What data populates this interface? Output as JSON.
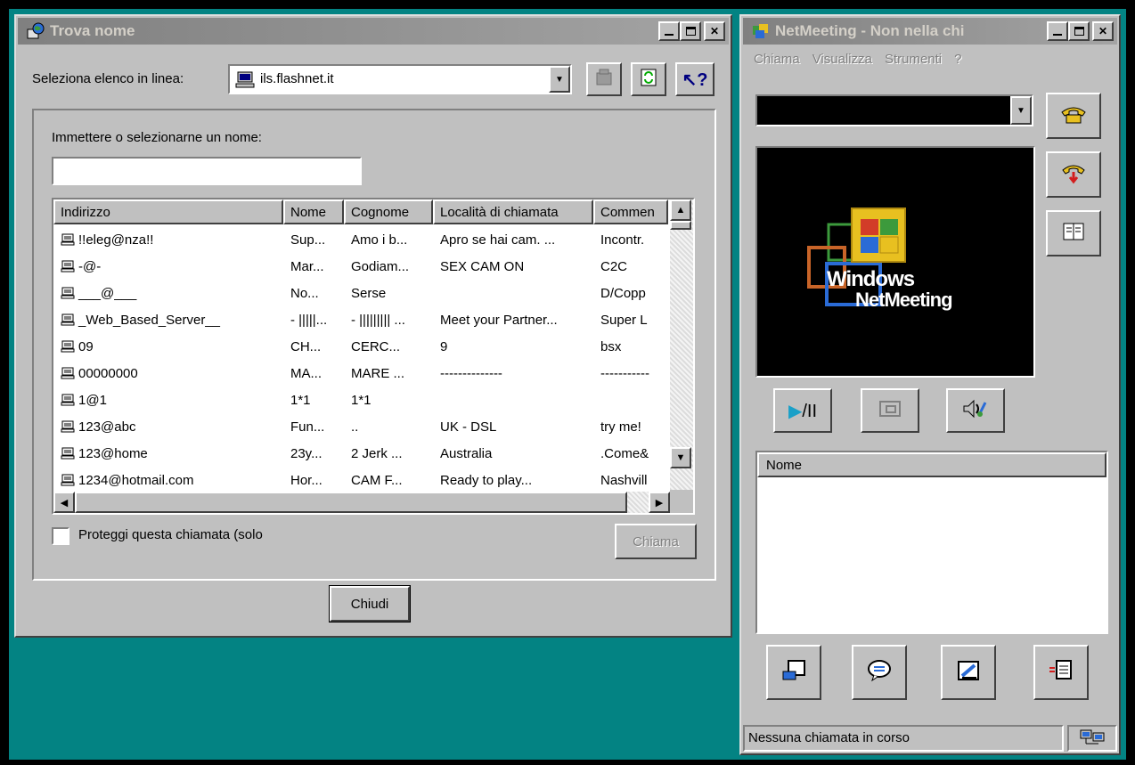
{
  "trova": {
    "title": "Trova nome",
    "select_label": "Seleziona elenco in linea:",
    "select_value": "ils.flashnet.it",
    "prompt_label": "Immettere o selezionarne un nome:",
    "name_input_value": "",
    "columns": [
      "Indirizzo",
      "Nome",
      "Cognome",
      "Località di chiamata",
      "Commen"
    ],
    "rows": [
      [
        "!!eleg@nza!!",
        "Sup...",
        "Amo i b...",
        "Apro se hai cam. ...",
        "Incontr."
      ],
      [
        "-@-",
        "Mar...",
        "Godiam...",
        "SEX CAM ON",
        "C2C"
      ],
      [
        "___@___",
        "No...",
        "Serse",
        "",
        "D/Copp"
      ],
      [
        "_Web_Based_Server__",
        "- |||||...",
        "- ||||||||| ...",
        "Meet your Partner...",
        "Super L"
      ],
      [
        "09",
        "CH...",
        "CERC...",
        "9",
        "bsx"
      ],
      [
        "00000000",
        "MA...",
        "MARE ...",
        "--------------",
        "-----------"
      ],
      [
        "1@1",
        "1*1",
        "1*1",
        "",
        ""
      ],
      [
        "123@abc",
        "Fun...",
        "..",
        "UK - DSL",
        "try me!"
      ],
      [
        "123@home",
        "23y...",
        "2 Jerk ...",
        "Australia",
        ".Come&"
      ],
      [
        "1234@hotmail.com",
        "Hor...",
        "CAM F...",
        "Ready to play...",
        "Nashvill"
      ]
    ],
    "protect_label": "Proteggi questa chiamata (solo",
    "protect_checked": false,
    "call_label": "Chiama",
    "close_label": "Chiudi"
  },
  "netmeeting": {
    "title": "NetMeeting - Non nella chi",
    "menu": [
      "Chiama",
      "Visualizza",
      "Strumenti",
      "?"
    ],
    "address_value": "",
    "logo_line1": "Windows",
    "logo_line2": "NetMeeting",
    "name_header": "Nome",
    "status": "Nessuna chiamata in corso"
  },
  "colors": {
    "desktop": "#038383",
    "face": "#c0c0c0",
    "inactive_title": "#808080",
    "video_bg": "#000000"
  },
  "icons": [
    "globe-book-icon",
    "computer-icon",
    "stop-icon",
    "refresh-icon",
    "help-pointer-icon",
    "phone-dial-icon",
    "hang-up-icon",
    "address-book-icon",
    "play-pause-icon",
    "picture-in-picture-icon",
    "audio-tuning-icon",
    "share-icon",
    "chat-icon",
    "whiteboard-icon",
    "file-transfer-icon",
    "network-status-icon"
  ]
}
